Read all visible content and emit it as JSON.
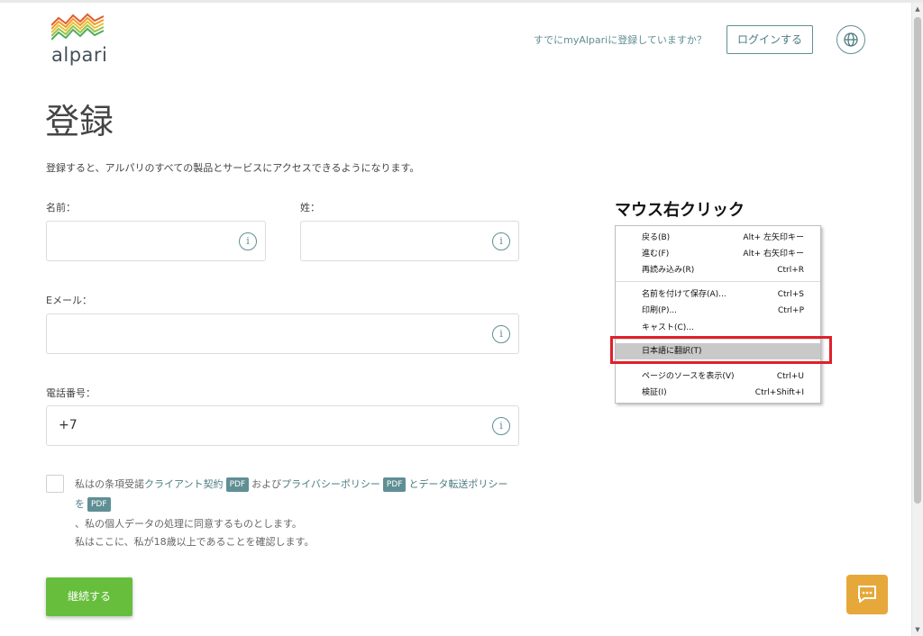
{
  "header": {
    "logo_text": "alpari",
    "already_registered": "すでにmyAlpariに登録していますか？",
    "login_label": "ログインする"
  },
  "page": {
    "title": "登録",
    "intro": "登録すると、アルパリのすべての製品とサービスにアクセスできるようになります。"
  },
  "form": {
    "first_name_label": "名前：",
    "last_name_label": "姓：",
    "email_label": "Eメール：",
    "phone_label": "電話番号：",
    "phone_value": "+7",
    "info_glyph": "i"
  },
  "consent": {
    "part1": "私はの条項受諾",
    "link_client": "クライアント契約",
    "pdf": "PDF",
    "part2": "および",
    "link_privacy": "プライバシーポリシー",
    "part3": "と",
    "link_transfer": "データ転送ポリシー",
    "part4": "を",
    "line2": "、私の個人データの処理に同意するものとします。",
    "line3": "私はここに、私が18歳以上であることを確認します。"
  },
  "continue_label": "継続する",
  "annotation": {
    "title": "マウス右クリック"
  },
  "context_menu": {
    "back": "戻る(B)",
    "back_sc": "Alt+ 左矢印キー",
    "forward": "進む(F)",
    "forward_sc": "Alt+ 右矢印キー",
    "reload": "再読み込み(R)",
    "reload_sc": "Ctrl+R",
    "save_as": "名前を付けて保存(A)...",
    "save_as_sc": "Ctrl+S",
    "print": "印刷(P)...",
    "print_sc": "Ctrl+P",
    "cast": "キャスト(C)...",
    "translate": "日本語に翻訳(T)",
    "view_source": "ページのソースを表示(V)",
    "view_source_sc": "Ctrl+U",
    "inspect": "検証(I)",
    "inspect_sc": "Ctrl+Shift+I"
  },
  "colors": {
    "accent": "#5f8f94",
    "continue": "#67be3d",
    "chat": "#e6a83a",
    "highlight_box": "#e0202a"
  },
  "icons": {
    "logo": "alpari-mountains-logo",
    "globe": "globe-icon",
    "info": "info-icon",
    "chat": "chat-icon"
  }
}
